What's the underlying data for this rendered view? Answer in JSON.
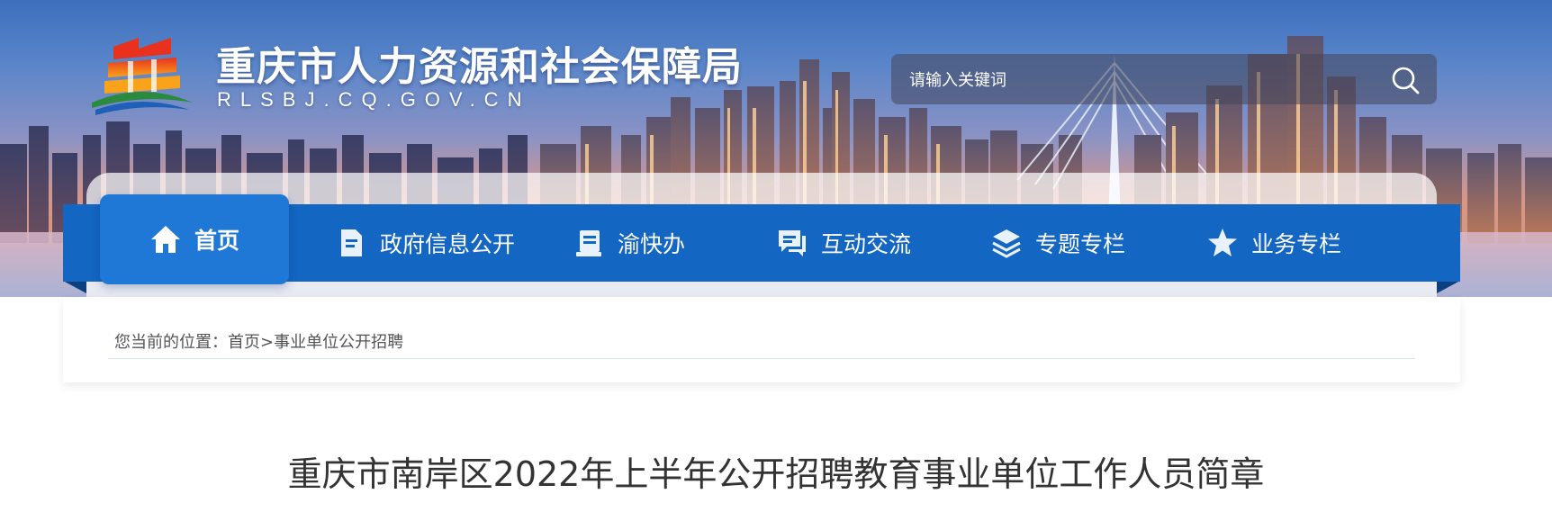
{
  "site": {
    "title": "重庆市人力资源和社会保障局",
    "domain": "RLSBJ.CQ.GOV.CN"
  },
  "search": {
    "placeholder": "请输入关键词",
    "icon": "search-icon"
  },
  "nav": {
    "items": [
      {
        "label": "首页",
        "icon": "home-icon",
        "active": true
      },
      {
        "label": "政府信息公开",
        "icon": "document-icon",
        "active": false
      },
      {
        "label": "渝快办",
        "icon": "service-icon",
        "active": false
      },
      {
        "label": "互动交流",
        "icon": "chat-icon",
        "active": false
      },
      {
        "label": "专题专栏",
        "icon": "layers-icon",
        "active": false
      },
      {
        "label": "业务专栏",
        "icon": "star-icon",
        "active": false
      }
    ]
  },
  "breadcrumb": {
    "prefix": "您当前的位置：",
    "home": "首页",
    "separator": ">",
    "current": "事业单位公开招聘"
  },
  "article": {
    "title": "重庆市南岸区2022年上半年公开招聘教育事业单位工作人员简章"
  },
  "colors": {
    "nav_bar": "#1366c1",
    "nav_active": "#2078d6",
    "text": "#333333",
    "breadcrumb_text": "#555555"
  }
}
